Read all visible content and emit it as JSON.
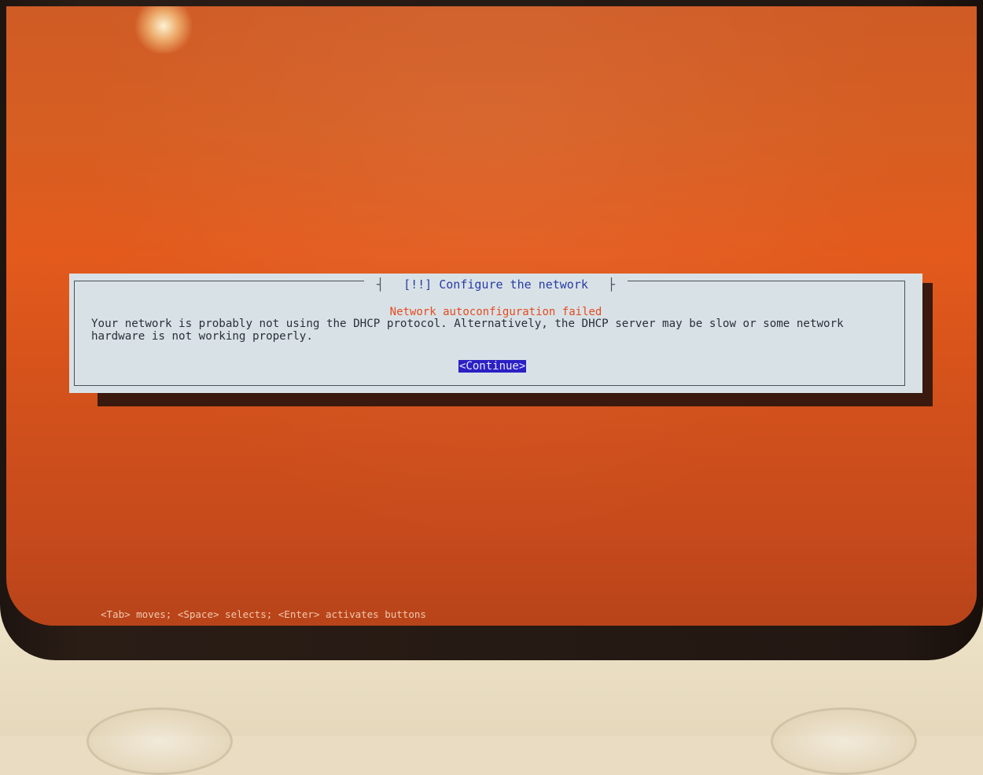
{
  "dialog": {
    "title": "[!!] Configure the network",
    "subtitle": "Network autoconfiguration failed",
    "message_line1": "Your network is probably not using the DHCP protocol. Alternatively, the DHCP server may be slow or some network",
    "message_line2": "hardware is not working properly.",
    "continue_label": "<Continue>"
  },
  "statusbar": {
    "hint": "<Tab> moves; <Space> selects; <Enter> activates buttons"
  },
  "colors": {
    "background": "#d65e22",
    "dialog": "#d8e2e6",
    "title": "#2a3aa8",
    "subtitle": "#e64a22",
    "button": "#2c20c4"
  }
}
